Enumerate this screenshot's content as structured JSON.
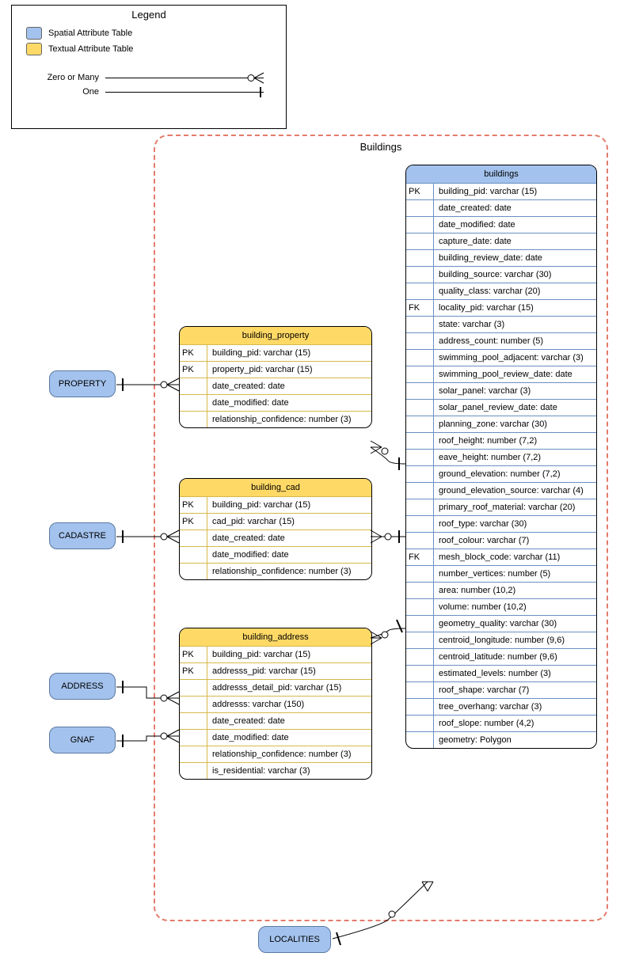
{
  "legend": {
    "title": "Legend",
    "spatial": "Spatial Attribute Table",
    "textual": "Textual Attribute Table",
    "zero_many": "Zero or Many",
    "one": "One"
  },
  "boundary": {
    "title": "Buildings"
  },
  "entities": {
    "property": "PROPERTY",
    "cadastre": "CADASTRE",
    "address": "ADDRESS",
    "gnaf": "GNAF",
    "localities": "LOCALITIES"
  },
  "tables": {
    "buildings": {
      "title": "buildings",
      "rows": [
        {
          "k": "PK",
          "v": "building_pid: varchar (15)"
        },
        {
          "k": "",
          "v": "date_created: date"
        },
        {
          "k": "",
          "v": "date_modified: date"
        },
        {
          "k": "",
          "v": "capture_date: date"
        },
        {
          "k": "",
          "v": "building_review_date: date"
        },
        {
          "k": "",
          "v": "building_source: varchar (30)"
        },
        {
          "k": "",
          "v": "quality_class: varchar (20)"
        },
        {
          "k": "FK",
          "v": "locality_pid: varchar (15)"
        },
        {
          "k": "",
          "v": "state: varchar (3)"
        },
        {
          "k": "",
          "v": "address_count: number (5)"
        },
        {
          "k": "",
          "v": "swimming_pool_adjacent: varchar (3)"
        },
        {
          "k": "",
          "v": "swimming_pool_review_date: date"
        },
        {
          "k": "",
          "v": "solar_panel: varchar (3)"
        },
        {
          "k": "",
          "v": "solar_panel_review_date: date"
        },
        {
          "k": "",
          "v": "planning_zone: varchar (30)"
        },
        {
          "k": "",
          "v": "roof_height: number (7,2)"
        },
        {
          "k": "",
          "v": "eave_height: number (7,2)"
        },
        {
          "k": "",
          "v": "ground_elevation: number (7,2)"
        },
        {
          "k": "",
          "v": "ground_elevation_source: varchar (4)"
        },
        {
          "k": "",
          "v": "primary_roof_material: varchar (20)"
        },
        {
          "k": "",
          "v": "roof_type: varchar (30)"
        },
        {
          "k": "",
          "v": "roof_colour: varchar (7)"
        },
        {
          "k": "FK",
          "v": "mesh_block_code: varchar (11)"
        },
        {
          "k": "",
          "v": "number_vertices: number (5)"
        },
        {
          "k": "",
          "v": "area: number (10,2)"
        },
        {
          "k": "",
          "v": "volume: number (10,2)"
        },
        {
          "k": "",
          "v": "geometry_quality: varchar (30)"
        },
        {
          "k": "",
          "v": "centroid_longitude: number (9,6)"
        },
        {
          "k": "",
          "v": "centroid_latitude: number (9,6)"
        },
        {
          "k": "",
          "v": "estimated_levels: number (3)"
        },
        {
          "k": "",
          "v": "roof_shape: varchar (7)"
        },
        {
          "k": "",
          "v": "tree_overhang: varchar (3)"
        },
        {
          "k": "",
          "v": "roof_slope: number (4,2)"
        },
        {
          "k": "",
          "v": "geometry: Polygon"
        }
      ]
    },
    "building_property": {
      "title": "building_property",
      "rows": [
        {
          "k": "PK",
          "v": "building_pid: varchar (15)"
        },
        {
          "k": "PK",
          "v": "property_pid: varchar (15)"
        },
        {
          "k": "",
          "v": "date_created: date"
        },
        {
          "k": "",
          "v": "date_modified: date"
        },
        {
          "k": "",
          "v": "relationship_confidence: number (3)"
        }
      ]
    },
    "building_cad": {
      "title": "building_cad",
      "rows": [
        {
          "k": "PK",
          "v": "building_pid: varchar (15)"
        },
        {
          "k": "PK",
          "v": "cad_pid: varchar (15)"
        },
        {
          "k": "",
          "v": "date_created: date"
        },
        {
          "k": "",
          "v": "date_modified: date"
        },
        {
          "k": "",
          "v": "relationship_confidence: number (3)"
        }
      ]
    },
    "building_address": {
      "title": "building_address",
      "rows": [
        {
          "k": "PK",
          "v": "building_pid: varchar (15)"
        },
        {
          "k": "PK",
          "v": "addresss_pid: varchar (15)"
        },
        {
          "k": "",
          "v": "addresss_detail_pid: varchar (15)"
        },
        {
          "k": "",
          "v": "addresss: varchar (150)"
        },
        {
          "k": "",
          "v": "date_created: date"
        },
        {
          "k": "",
          "v": "date_modified: date"
        },
        {
          "k": "",
          "v": "relationship_confidence: number (3)"
        },
        {
          "k": "",
          "v": "is_residential: varchar (3)"
        }
      ]
    }
  }
}
